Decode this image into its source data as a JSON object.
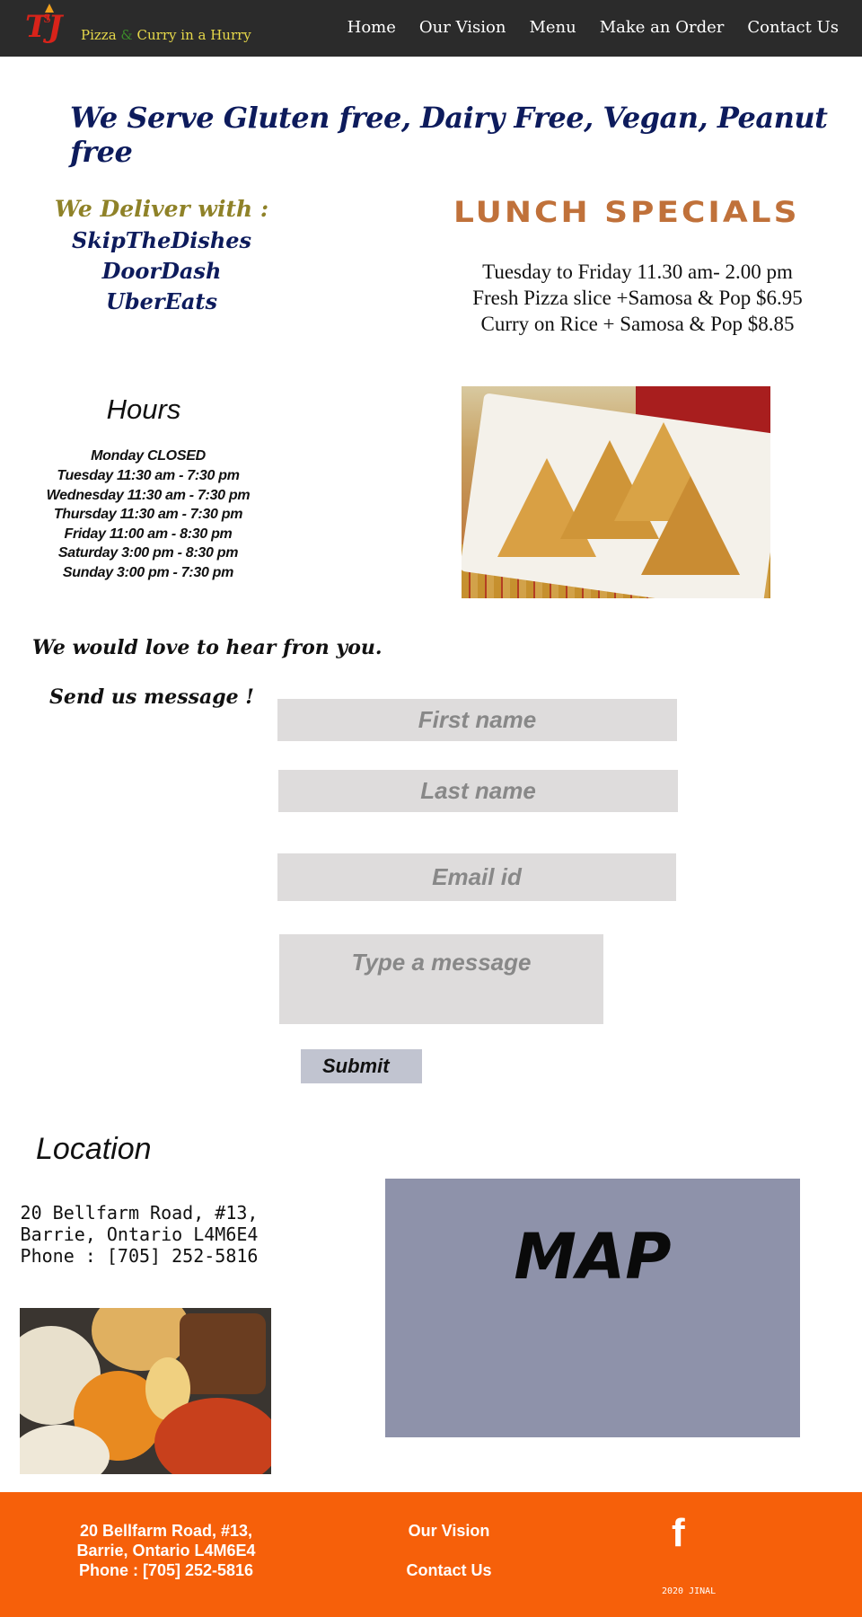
{
  "header": {
    "logo_text": "TJ's",
    "tagline_part1": "Pizza ",
    "tagline_amp": "&",
    "tagline_part2": " Curry in a Hurry",
    "nav": [
      "Home",
      "Our Vision",
      "Menu",
      "Make an Order",
      "Contact Us"
    ]
  },
  "headline": "We Serve Gluten free, Dairy Free, Vegan, Peanut free",
  "delivery": {
    "title": "We Deliver with :",
    "services": [
      "SkipTheDishes",
      "DoorDash",
      "UberEats"
    ]
  },
  "lunch": {
    "title": "LUNCH SPECIALS",
    "lines": [
      "Tuesday to Friday 11.30 am- 2.00 pm",
      "Fresh Pizza slice +Samosa & Pop $6.95",
      "Curry on Rice + Samosa & Pop $8.85"
    ]
  },
  "hours": {
    "title": "Hours",
    "lines": [
      "Monday CLOSED",
      "Tuesday 11:30 am - 7:30 pm",
      "Wednesday 11:30 am - 7:30 pm",
      "Thursday 11:30 am -  7:30 pm",
      "Friday 11:00 am  - 8:30 pm",
      "Saturday 3:00 pm - 8:30 pm",
      "Sunday 3:00 pm - 7:30 pm"
    ]
  },
  "contact_form": {
    "intro": "We would love to hear fron you.",
    "send_label": "Send us message !",
    "first_name_placeholder": "First name",
    "last_name_placeholder": "Last name",
    "email_placeholder": "Email id",
    "message_placeholder": "Type a message",
    "submit_label": "Submit"
  },
  "location": {
    "title": "Location",
    "address_lines": [
      "20 Bellfarm Road, #13,",
      "Barrie, Ontario L4M6E4",
      "Phone : [705] 252-5816"
    ],
    "map_label": "MAP"
  },
  "footer": {
    "address_lines": [
      "20 Bellfarm Road, #13,",
      "Barrie, Ontario L4M6E4",
      "Phone : [705] 252-5816"
    ],
    "links": [
      "Our Vision",
      "Contact Us"
    ],
    "social_icon": "f",
    "copyright": "2020 JINAL"
  }
}
